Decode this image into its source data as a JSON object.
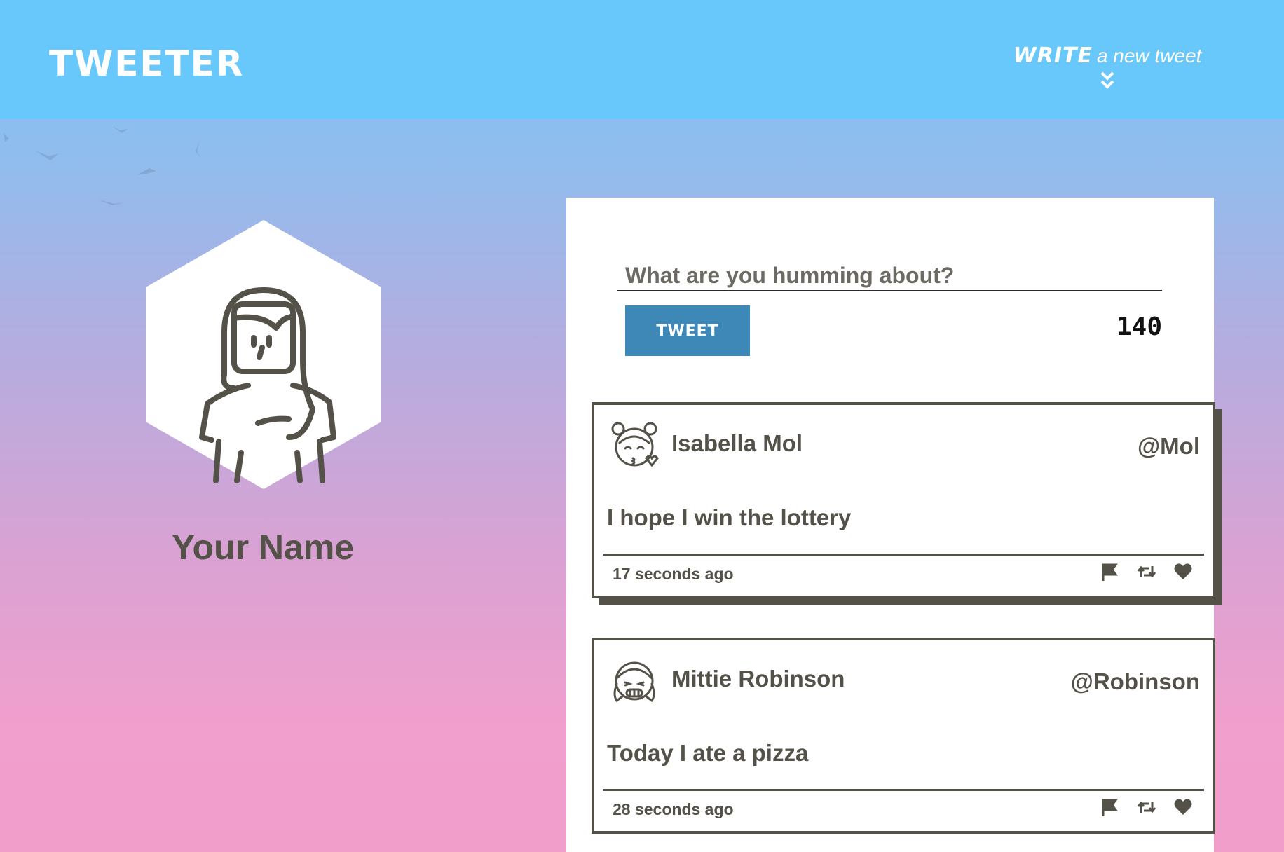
{
  "header": {
    "logo": "TWEETER",
    "compose_word1": "WRITE",
    "compose_word2": "a new tweet"
  },
  "profile": {
    "name": "Your Name"
  },
  "composer": {
    "placeholder": "What are you humming about?",
    "button_label": "TWEET",
    "char_count": "140"
  },
  "tweets": [
    {
      "author": "Isabella Mol",
      "handle": "@Mol",
      "text": "I hope I win the lottery",
      "time": "17 seconds ago"
    },
    {
      "author": "Mittie Robinson",
      "handle": "@Robinson",
      "text": "Today I ate a pizza",
      "time": "28 seconds ago"
    }
  ],
  "colors": {
    "header_bg": "#69c8fb",
    "button_bg": "#3e88b8",
    "text": "#545149"
  },
  "icons": [
    "chevron-double-down-icon",
    "flag-icon",
    "retweet-icon",
    "heart-icon"
  ]
}
